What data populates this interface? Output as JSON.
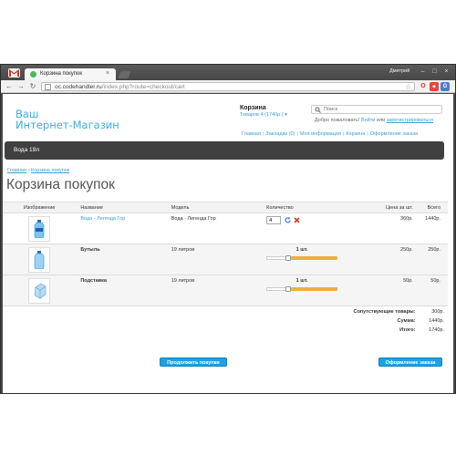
{
  "browser": {
    "user_name": "Дмитрий",
    "tab_title": "Корзина покупок",
    "url_host": "oc.codehandler.ru",
    "url_path": "/index.php?route=checkout/cart",
    "icons": {
      "back": "back-arrow-icon",
      "forward": "forward-arrow-icon",
      "reload": "reload-icon",
      "bookmark": "star-icon"
    }
  },
  "header": {
    "logo_line1": "Ваш",
    "logo_line2": "Интернет-Магазин",
    "cart_title": "Корзина",
    "cart_summary": "Товаров 4 (1740р.)",
    "search_placeholder": "Поиск",
    "welcome_text": "Добро пожаловать!",
    "login_link": "Войти",
    "or_text": "или",
    "register_link": "зарегистрироваться",
    "links": [
      "Главная",
      "Закладки (0)",
      "Моя информация",
      "Корзина",
      "Оформление заказа"
    ],
    "accent_color": "#38b0de"
  },
  "menu": {
    "item": "Вода 19л"
  },
  "breadcrumb": [
    "Главная",
    "Корзина покупок"
  ],
  "page_title": "Корзина покупок",
  "table": {
    "headers": [
      "Изображение",
      "Название",
      "Модель",
      "Количество",
      "Цена за шт.",
      "Всего"
    ],
    "rows": [
      {
        "name": "Вода - Легенда Гор",
        "model": "Вода - Легенда Гор",
        "qty": "4",
        "price": "360р.",
        "total": "1440р."
      },
      {
        "name": "Бутыль",
        "model": "19 литров",
        "qty_label": "1 шт.",
        "qty_fraction": 0.7,
        "price": "250р.",
        "total": "250р."
      },
      {
        "name": "Подставка",
        "model": "19 литров",
        "qty_label": "1 шт.",
        "qty_fraction": 0.7,
        "price": "50р.",
        "total": "50р."
      }
    ]
  },
  "totals": {
    "related_label": "Сопутствующие товары:",
    "related_value": "300р.",
    "sum_label": "Сумма:",
    "sum_value": "1440р.",
    "total_label": "Итого:",
    "total_value": "1740р."
  },
  "buttons": {
    "continue": "Продолжить покупки",
    "checkout": "Оформление заказа"
  }
}
